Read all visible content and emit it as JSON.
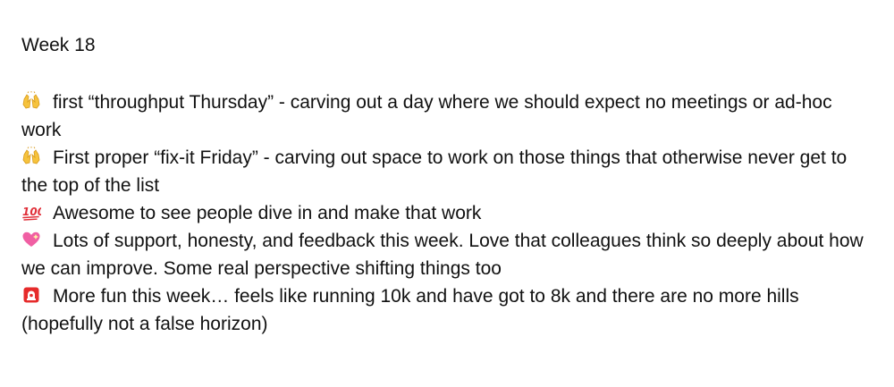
{
  "document": {
    "title": "Week 18",
    "entries": [
      {
        "icon": "raising-hands-icon",
        "text": "first “throughput Thursday” - carving out a day where we should expect no meetings or ad-hoc work"
      },
      {
        "icon": "raising-hands-icon",
        "text": "First proper “fix-it Friday” - carving out space to work on those things that otherwise never get to the top of the list"
      },
      {
        "icon": "hundred-points-icon",
        "text": "Awesome to see people dive in and make that work"
      },
      {
        "icon": "sparkling-heart-icon",
        "text": "Lots of support, honesty, and feedback this week. Love that colleagues think so deeply about how we can improve. Some real perspective shifting things too"
      },
      {
        "icon": "police-light-icon",
        "text": "More fun this week… feels like running 10k and have got to 8k and there are no more hills (hopefully not a false horizon)"
      }
    ]
  },
  "colors": {
    "text": "#111111",
    "hands": "#f6c33d",
    "hundred": "#e0303a",
    "heart": "#f05fa3",
    "siren": "#e62b2b"
  }
}
